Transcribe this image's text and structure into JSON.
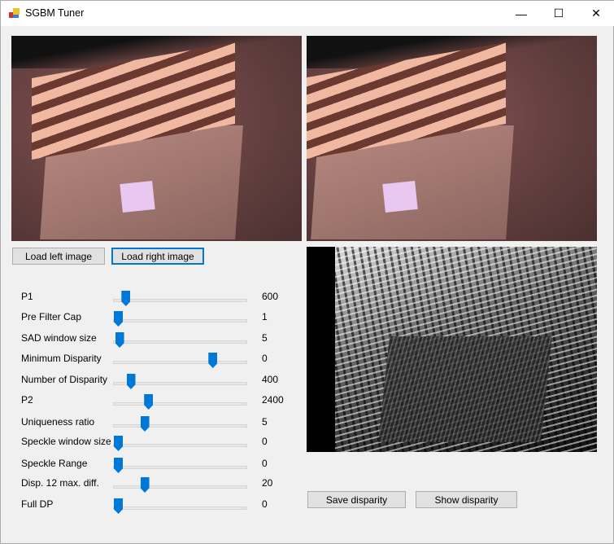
{
  "window": {
    "title": "SGBM Tuner",
    "minimize": "—",
    "maximize": "☐",
    "close": "✕"
  },
  "buttons": {
    "load_left": "Load left image",
    "load_right": "Load right image",
    "save_disparity": "Save disparity",
    "show_disparity": "Show disparity"
  },
  "sliders": [
    {
      "label": "P1",
      "value": "600",
      "position": 0.06
    },
    {
      "label": "Pre Filter Cap",
      "value": "1",
      "position": 0.0
    },
    {
      "label": "SAD window size",
      "value": "5",
      "position": 0.01
    },
    {
      "label": "Minimum Disparity",
      "value": "0",
      "position": 0.75
    },
    {
      "label": "Number of Disparity",
      "value": "400",
      "position": 0.1
    },
    {
      "label": "P2",
      "value": "2400",
      "position": 0.24
    },
    {
      "label": "Uniqueness ratio",
      "value": "5",
      "position": 0.21
    },
    {
      "label": "Speckle window size",
      "value": "0",
      "position": 0.0
    },
    {
      "label": "Speckle Range",
      "value": "0",
      "position": 0.0
    },
    {
      "label": "Disp. 12 max. diff.",
      "value": "20",
      "position": 0.21
    },
    {
      "label": "Full DP",
      "value": "0",
      "position": 0.0
    }
  ],
  "colors": {
    "accent": "#0078d7"
  }
}
